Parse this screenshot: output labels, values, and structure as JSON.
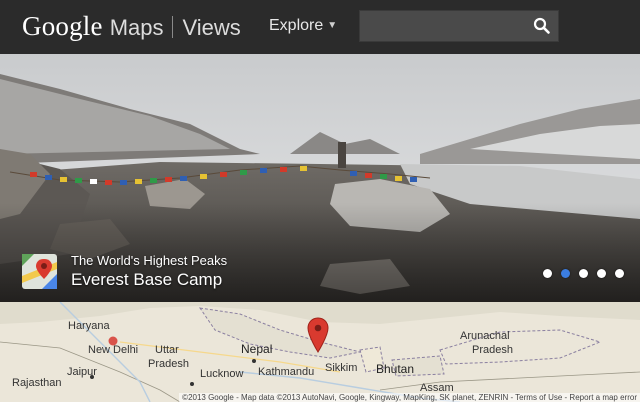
{
  "header": {
    "brand_google": "Google",
    "brand_maps": "Maps",
    "brand_views": "Views",
    "explore_label": "Explore",
    "search": {
      "placeholder": "",
      "value": "",
      "icon": "search-icon"
    }
  },
  "hero": {
    "subtitle": "The World's Highest Peaks",
    "title": "Everest Base Camp",
    "carousel": {
      "count": 5,
      "active_index": 1
    }
  },
  "map": {
    "labels": {
      "haryana": "Haryana",
      "new_delhi": "New Delhi",
      "uttar_pradesh_1": "Uttar",
      "uttar_pradesh_2": "Pradesh",
      "nepal": "Nepal",
      "jaipur": "Jaipur",
      "lucknow": "Lucknow",
      "kathmandu": "Kathmandu",
      "sikkim": "Sikkim",
      "bhutan": "Bhutan",
      "arunachal_1": "Arunachal",
      "arunachal_2": "Pradesh",
      "rajasthan": "Rajasthan",
      "assam": "Assam"
    },
    "attribution": "©2013 Google - Map data ©2013 AutoNavi, Google, Kingway, MapKing, SK planet, ZENRIN - Terms of Use - Report a map error",
    "colors": {
      "marker": "#d93a2f",
      "land": "#ebe6d9",
      "border": "#8a7fa0"
    }
  }
}
